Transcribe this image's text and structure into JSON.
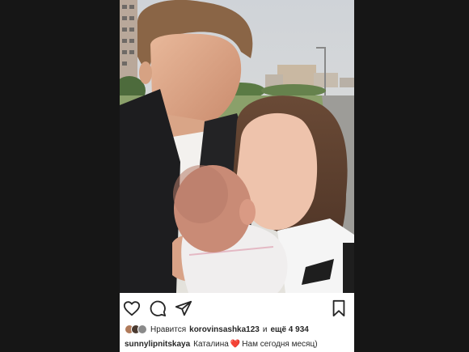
{
  "post": {
    "photo": {
      "alt_icon": "photo"
    },
    "actions": {
      "like_icon": "heart-outline-icon",
      "comment_icon": "comment-bubble-icon",
      "share_icon": "paper-plane-icon",
      "save_icon": "bookmark-icon"
    },
    "likes": {
      "prefix": "Нравится",
      "user": "korovinsashka123",
      "connector": "и",
      "others": "ещё 4 934",
      "avatar_colors": [
        "#b07a5a",
        "#4a3a30",
        "#8a8a8a"
      ]
    },
    "caption": {
      "username": "sunnylipnitskaya",
      "text_before": "Каталина",
      "emoji": "❤️",
      "text_after": "Нам сегодня месяц)"
    }
  },
  "colors": {
    "background": "#161616",
    "card": "#ffffff",
    "text": "#262626"
  }
}
